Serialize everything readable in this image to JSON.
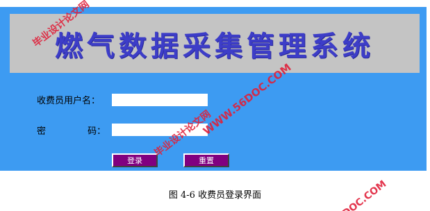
{
  "app": {
    "title": "燃气数据采集管理系统"
  },
  "form": {
    "username_label": "收费员用户名：",
    "password_label_char1": "密",
    "password_label_char2": "码：",
    "username_value": "",
    "password_value": ""
  },
  "buttons": {
    "login_label": "登录",
    "reset_label": "重置"
  },
  "caption": "图 4-6  收费员登录界面",
  "watermarks": {
    "wm1": "毕业设计论文网",
    "wm2": "毕业设计论文网",
    "wm3": "WWW.56DOC.COM",
    "wm4": "DOC.COM"
  },
  "colors": {
    "window_bg": "#3d9bf2",
    "banner_bg": "#c4c4c4",
    "title_color": "#3d3dc8",
    "button_bg": "#800080",
    "watermark": "#e0203a"
  }
}
